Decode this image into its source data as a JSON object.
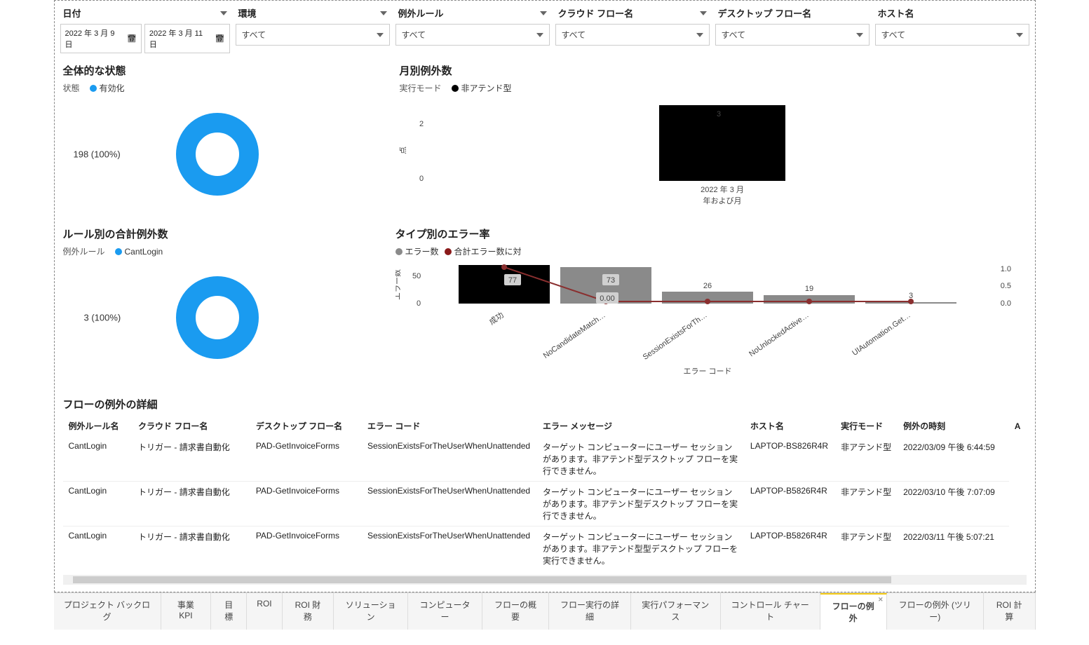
{
  "filters": {
    "date": {
      "label": "日付",
      "from": "2022 年 3 月 9 日",
      "to": "2022 年 3 月 11 日"
    },
    "env": {
      "label": "環境",
      "value": "すべて"
    },
    "rule": {
      "label": "例外ルール",
      "value": "すべて"
    },
    "cloudflow": {
      "label": "クラウド フロー名",
      "value": "すべて"
    },
    "desktopflow": {
      "label": "デスクトップ フロー名",
      "value": "すべて"
    },
    "host": {
      "label": "ホスト名",
      "value": "すべて"
    }
  },
  "overall": {
    "title": "全体的な状態",
    "legend_label": "状態",
    "series_name": "有効化",
    "data_label": "198 (100%)"
  },
  "monthly": {
    "title": "月別例外数",
    "legend_label": "実行モード",
    "series_name": "非アテンド型",
    "xlabel": "年および月",
    "ylabel": "点",
    "category": "2022 年 3 月",
    "value_label": "3",
    "tick0": "0",
    "tick2": "2"
  },
  "byrule": {
    "title": "ルール別の合計例外数",
    "legend_label": "例外ルール",
    "series_name": "CantLogin",
    "data_label": "3 (100%)"
  },
  "errorrate": {
    "title": "タイプ別のエラー率",
    "series1": "エラー数",
    "series2": "合計エラー数に対",
    "xlabel": "エラー コード",
    "ylabel": "エラー数",
    "tick0": "0",
    "tick50": "50",
    "rtick0": "0.0",
    "rtick05": "0.5",
    "rtick1": "1.0",
    "line_label": "0.00",
    "cats": [
      "成功",
      "NoCandidateMatch…",
      "SessionExistsForTh…",
      "NoUnlockedActive…",
      "UIAutomation.Get…"
    ],
    "vals": [
      "77",
      "73",
      "26",
      "19",
      "3"
    ]
  },
  "details": {
    "title": "フローの例外の詳細",
    "cols": [
      "例外ルール名",
      "クラウド フロー名",
      "デスクトップ フロー名",
      "エラー コード",
      "エラー メッセージ",
      "ホスト名",
      "実行モード",
      "例外の時刻",
      "A"
    ],
    "rows": [
      [
        "CantLogin",
        "トリガー - 請求書自動化",
        "PAD-GetInvoiceForms",
        "SessionExistsForTheUserWhenUnattended",
        "ターゲット コンピューターにユーザー セッションがあります。非アテンド型デスクトップ フローを実行できません。",
        "LAPTOP-BS826R4R",
        "非アテンド型",
        "2022/03/09 午後 6:44:59"
      ],
      [
        "CantLogin",
        "トリガー - 請求書自動化",
        "PAD-GetInvoiceForms",
        "SessionExistsForTheUserWhenUnattended",
        "ターゲット コンピューターにユーザー セッションがあります。非アテンド型デスクトップ フローを実行できません。",
        "LAPTOP-B5826R4R",
        "非アテンド型",
        "2022/03/10 午後 7:07:09"
      ],
      [
        "CantLogin",
        "トリガー - 請求書自動化",
        "PAD-GetInvoiceForms",
        "SessionExistsForTheUserWhenUnattended",
        "ターゲット コンピューターにユーザー セッションがあります。非アテンド型型デスクトップ フローを実行できません。",
        "LAPTOP-B5826R4R",
        "非アテンド型",
        "2022/03/11 午後 5:07:21"
      ]
    ]
  },
  "tabs": [
    "プロジェクト バックログ",
    "事業 KPI",
    "目標",
    "ROI",
    "ROI 財務",
    "ソリューション",
    "コンピューター",
    "フローの概要",
    "フロー実行の詳細",
    "実行パフォーマンス",
    "コントロール チャート",
    "フローの例外",
    "フローの例外 (ツリー)",
    "ROI 計算"
  ],
  "active_tab": 11,
  "colors": {
    "blue": "#1a9bf0",
    "black": "#000",
    "gray": "#8a8a8a",
    "darkred": "#8a1a1a"
  },
  "chart_data": [
    {
      "type": "pie",
      "title": "全体的な状態",
      "series": [
        {
          "name": "有効化",
          "value": 198,
          "pct": 100
        }
      ]
    },
    {
      "type": "bar",
      "title": "月別例外数",
      "xlabel": "年および月",
      "ylabel": "点",
      "categories": [
        "2022 年 3 月"
      ],
      "values": [
        3
      ],
      "ylim": [
        0,
        3
      ],
      "series_name": "非アテンド型"
    },
    {
      "type": "pie",
      "title": "ルール別の合計例外数",
      "series": [
        {
          "name": "CantLogin",
          "value": 3,
          "pct": 100
        }
      ]
    },
    {
      "type": "bar",
      "title": "タイプ別のエラー率",
      "xlabel": "エラー コード",
      "ylabel": "エラー数",
      "categories": [
        "成功",
        "NoCandidateMatch…",
        "SessionExistsForTh…",
        "NoUnlockedActive…",
        "UIAutomation.Get…"
      ],
      "series": [
        {
          "name": "エラー数",
          "values": [
            77,
            73,
            26,
            19,
            3
          ]
        },
        {
          "name": "合計エラー数に対",
          "values": [
            1.0,
            0.0,
            0.0,
            0.0,
            0.0
          ],
          "axis": "right"
        }
      ],
      "ylim": [
        0,
        80
      ],
      "y2lim": [
        0.0,
        1.0
      ]
    }
  ]
}
